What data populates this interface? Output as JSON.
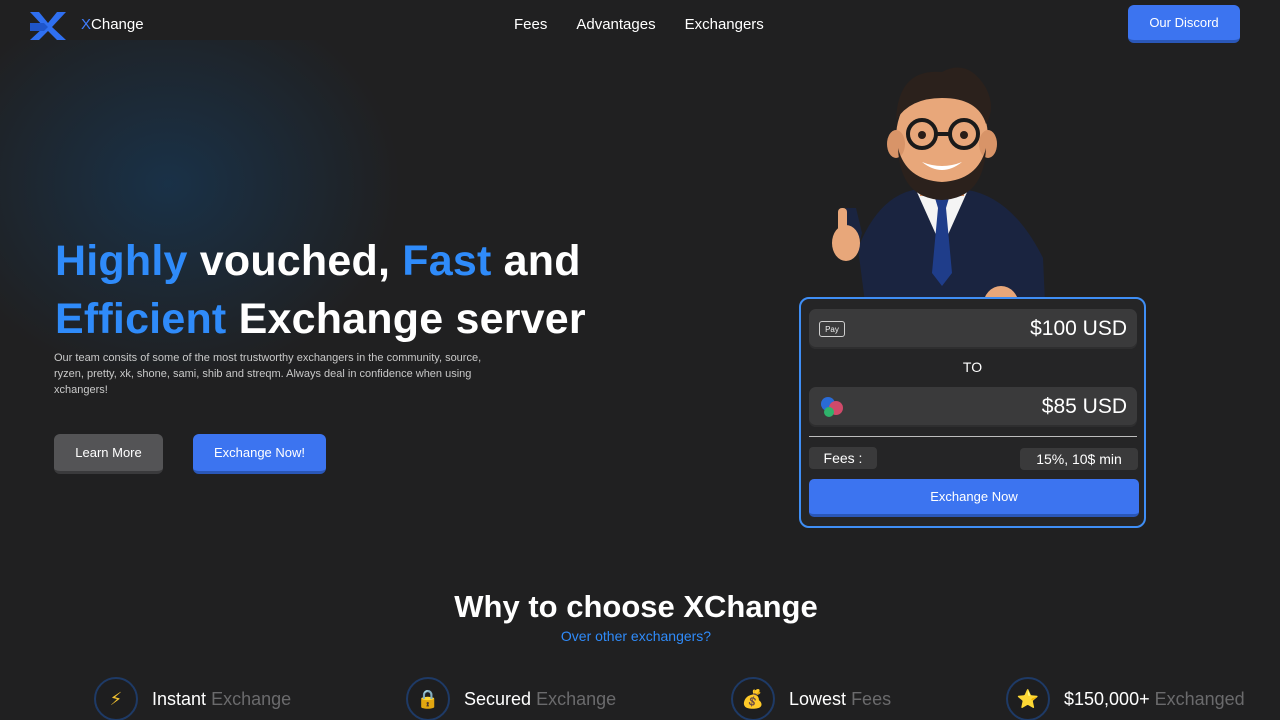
{
  "brand": {
    "logo_letter": "X",
    "logo_rest": "Change"
  },
  "nav": {
    "items": [
      "Fees",
      "Advantages",
      "Exchangers"
    ],
    "discord_label": "Our Discord"
  },
  "hero": {
    "title_parts": [
      "Highly",
      " vouched, ",
      "Fast",
      " and",
      "Efficient",
      " Exchange server"
    ],
    "description": "Our team consits of some of the most trustworthy exchangers in the community, source, ryzen, pretty, xk, shone, sami, shib and streqm. Always deal in confidence when using xchangers!",
    "learn_more": "Learn More",
    "exchange_now": "Exchange Now!"
  },
  "widget": {
    "from_icon": "Pay",
    "from_amount": "$100 USD",
    "to_label": "TO",
    "to_amount": "$85 USD",
    "fees_label": "Fees :",
    "fees_value": "15%, 10$ min",
    "button": "Exchange Now"
  },
  "why": {
    "title": "Why to choose XChange",
    "subtitle": "Over other exchangers?",
    "features": [
      {
        "main": "Instant",
        "muted": "Exchange",
        "icon": "lightning-icon"
      },
      {
        "main": "Secured",
        "muted": "Exchange",
        "icon": "lock-icon"
      },
      {
        "main": "Lowest",
        "muted": "Fees",
        "icon": "money-bag-icon"
      },
      {
        "main": "$150,000+",
        "muted": "Exchanged",
        "icon": "star-icon"
      }
    ]
  },
  "colors": {
    "accent": "#3c74f0",
    "highlight_blue": "#2f8bfa",
    "background": "#202021"
  }
}
